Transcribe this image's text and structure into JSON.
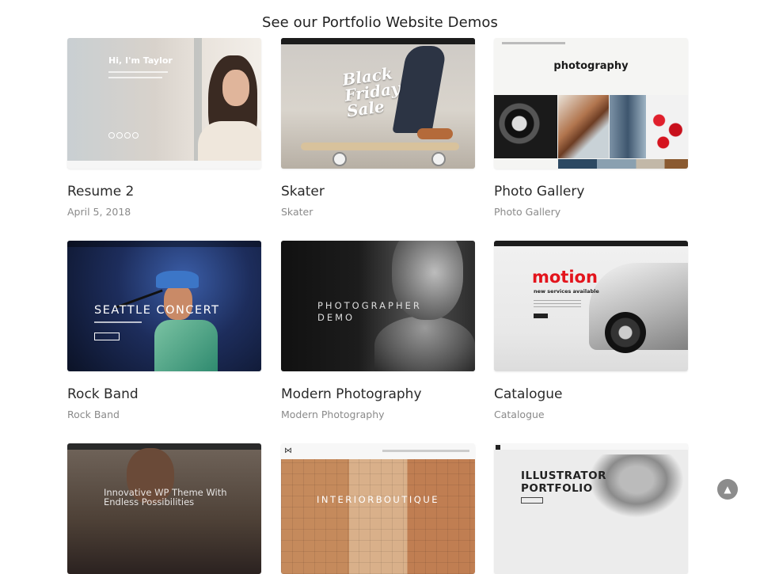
{
  "heading": "See our Portfolio Website Demos",
  "cards": [
    {
      "title": "Resume 2",
      "subtitle": "April 5, 2018",
      "thumb": {
        "hi": "Hi, I'm Taylor"
      }
    },
    {
      "title": "Skater",
      "subtitle": "Skater",
      "thumb": {
        "script_line1": "Black",
        "script_line2": "Friday",
        "script_line3": "Sale"
      }
    },
    {
      "title": "Photo Gallery",
      "subtitle": "Photo Gallery",
      "thumb": {
        "title": "photography"
      }
    },
    {
      "title": "Rock Band",
      "subtitle": "Rock Band",
      "thumb": {
        "title": "SEATTLE CONCERT"
      }
    },
    {
      "title": "Modern Photography",
      "subtitle": "Modern Photography",
      "thumb": {
        "line1": "PHOTOGRAPHER",
        "line2": "DEMO"
      }
    },
    {
      "title": "Catalogue",
      "subtitle": "Catalogue",
      "thumb": {
        "title": "motion",
        "subtitle": "new services available"
      }
    },
    {
      "title": "",
      "subtitle": "",
      "thumb": {
        "line1": "Innovative WP Theme With",
        "line2": "Endless Possibilities"
      }
    },
    {
      "title": "",
      "subtitle": "",
      "thumb": {
        "title": "INTERIORBOUTIQUE"
      }
    },
    {
      "title": "",
      "subtitle": "",
      "thumb": {
        "line1": "ILLUSTRATOR",
        "line2": "PORTFOLIO"
      }
    }
  ],
  "scroll_top_icon": "chevron-up-icon",
  "colors": {
    "background": "#ffffff",
    "title": "#2a2a2a",
    "subtitle": "#8a8a8a",
    "scroll_button": "#8c8c8c"
  }
}
